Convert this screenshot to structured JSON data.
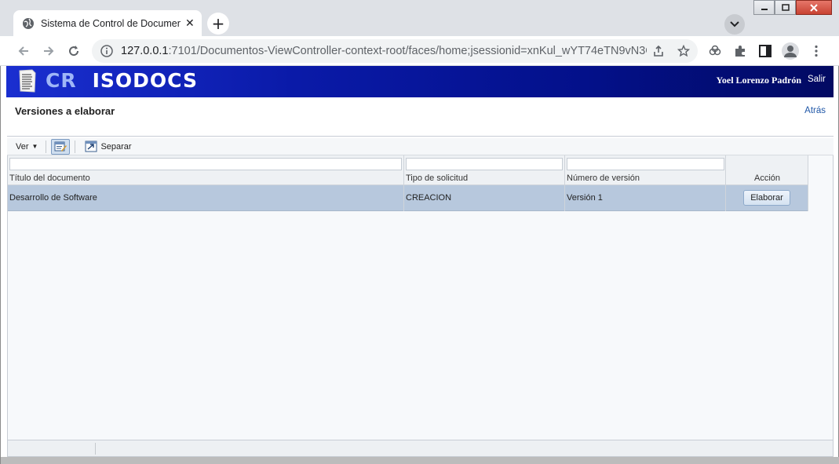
{
  "browser": {
    "tab_title": "Sistema de Control de Document",
    "url_host": "127.0.0.1",
    "url_rest": ":7101/Documentos-ViewController-context-root/faces/home;jsessionid=xnKul_wYT74eTN9vN3Gh...",
    "new_tab": "+",
    "tab_close": "✕"
  },
  "app": {
    "brand_cr": "CR",
    "brand_name": "ISODOCS",
    "user_name": "Yoel Lorenzo Padrón",
    "logout": "Salir",
    "page_title": "Versiones a elaborar",
    "back": "Atrás"
  },
  "toolbar": {
    "view_label": "Ver",
    "detach_label": "Separar"
  },
  "table": {
    "columns": [
      "Título del documento",
      "Tipo de solicitud",
      "Número de versión",
      "Acción"
    ],
    "rows": [
      {
        "title": "Desarrollo de Software",
        "request_type": "CREACION",
        "version": "Versión 1",
        "action_label": "Elaborar"
      }
    ]
  },
  "colors": {
    "banner_start": "#1a2fd0",
    "banner_end": "#020a62",
    "selected_row": "#b7c8dd"
  }
}
